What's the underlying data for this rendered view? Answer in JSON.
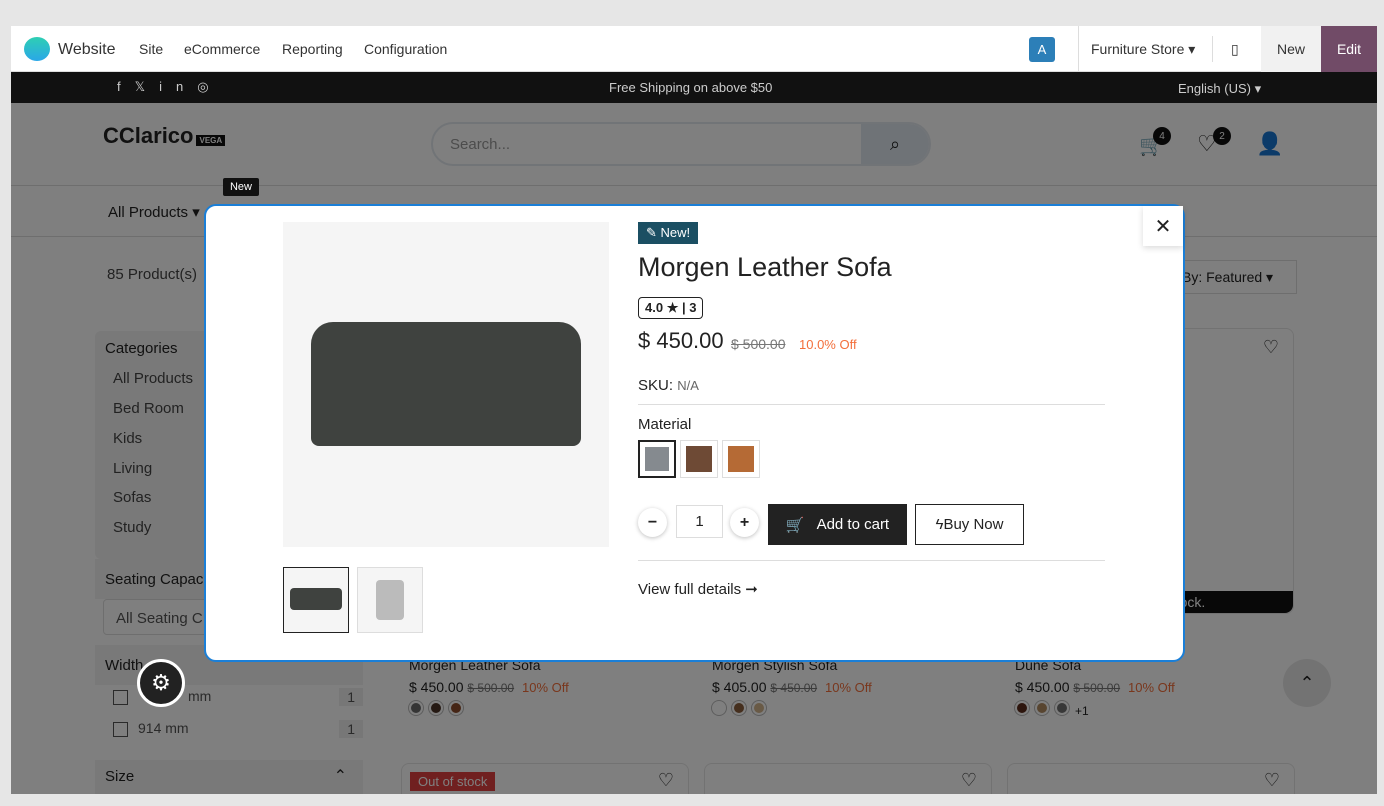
{
  "topbar": {
    "app": "Website",
    "menu": [
      "Site",
      "eCommerce",
      "Reporting",
      "Configuration"
    ],
    "avatar": "A",
    "store": "Furniture Store",
    "new": "New",
    "edit": "Edit"
  },
  "announce": {
    "text": "Free Shipping on above $50",
    "language": "English (US)"
  },
  "header": {
    "logo": "Clarico",
    "logo_sub": "VEGA",
    "search_placeholder": "Search...",
    "cart_count": "4",
    "wishlist_count": "2"
  },
  "nav": {
    "all_products": "All Products",
    "tooltip": "New"
  },
  "listing": {
    "count": "85 Product(s)",
    "sort": "By: Featured"
  },
  "sidebar": {
    "categories_title": "Categories",
    "categories": [
      "All Products",
      "Bed Room",
      "Kids",
      "Living",
      "Sofas",
      "Study"
    ],
    "seating_title": "Seating Capac",
    "seating_select": "All Seating C",
    "width_title": "Width",
    "widths": [
      {
        "label": "mm",
        "count": "1"
      },
      {
        "label": "914 mm",
        "count": "1"
      }
    ],
    "size_title": "Size"
  },
  "products": [
    {
      "name": "Morgen Leather Sofa",
      "price": "$ 450.00",
      "old": "$ 500.00",
      "off": "10% Off",
      "colors": [
        "#6b6b6b",
        "#4a3326",
        "#8a4a2a"
      ]
    },
    {
      "name": "Morgen Stylish Sofa",
      "price": "$ 405.00",
      "old": "$ 450.00",
      "off": "10% Off",
      "colors": [
        "#ffffff",
        "#8b5e3c",
        "#d2b48c"
      ]
    },
    {
      "name": "Dune Sofa",
      "price": "$ 450.00",
      "old": "$ 500.00",
      "off": "10% Off",
      "colors": [
        "#5a2a1a",
        "#b08a60",
        "#707070"
      ],
      "more": "+1"
    }
  ],
  "stock_label": "n stock.",
  "out_of_stock": "Out of stock",
  "modal": {
    "badge": "New!",
    "title": "Morgen Leather Sofa",
    "rating": "4.0",
    "reviews": "3",
    "price": "$ 450.00",
    "old_price": "$ 500.00",
    "discount": "10.0% Off",
    "sku_label": "SKU:",
    "sku": "N/A",
    "attribute": "Material",
    "materials": [
      "#858a8f",
      "#6e4a35",
      "#b56a35"
    ],
    "qty": "1",
    "add_to_cart": "Add to cart",
    "buy_now": "Buy Now",
    "details": "View full details"
  }
}
